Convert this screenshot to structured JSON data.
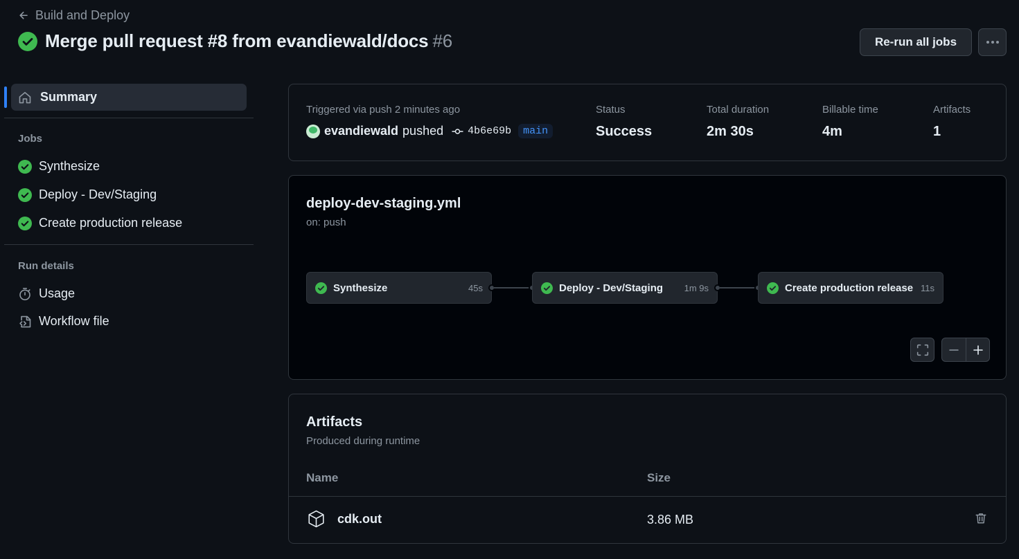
{
  "header": {
    "back_label": "Build and Deploy",
    "title": "Merge pull request #8 from evandiewald/docs",
    "run_number": "#6",
    "rerun_label": "Re-run all jobs",
    "more_icon": "kebab-horizontal-icon"
  },
  "sidebar": {
    "summary_label": "Summary",
    "jobs_heading": "Jobs",
    "jobs": [
      {
        "label": "Synthesize",
        "status": "success"
      },
      {
        "label": "Deploy - Dev/Staging",
        "status": "success"
      },
      {
        "label": "Create production release",
        "status": "success"
      }
    ],
    "run_details_heading": "Run details",
    "run_details": [
      {
        "label": "Usage",
        "icon": "stopwatch-icon"
      },
      {
        "label": "Workflow file",
        "icon": "file-code-icon"
      }
    ]
  },
  "summary": {
    "triggered_text": "Triggered via push 2 minutes ago",
    "actor": "evandiewald",
    "action": "pushed",
    "commit": "4b6e69b",
    "branch": "main",
    "status_label": "Status",
    "status_value": "Success",
    "duration_label": "Total duration",
    "duration_value": "2m 30s",
    "billable_label": "Billable time",
    "billable_value": "4m",
    "artifacts_label": "Artifacts",
    "artifacts_value": "1"
  },
  "workflow": {
    "file_name": "deploy-dev-staging.yml",
    "trigger": "on: push",
    "jobs": [
      {
        "name": "Synthesize",
        "duration": "45s"
      },
      {
        "name": "Deploy - Dev/Staging",
        "duration": "1m 9s"
      },
      {
        "name": "Create production release",
        "duration": "11s"
      }
    ]
  },
  "artifacts": {
    "title": "Artifacts",
    "subtitle": "Produced during runtime",
    "col_name": "Name",
    "col_size": "Size",
    "items": [
      {
        "name": "cdk.out",
        "size": "3.86 MB"
      }
    ]
  },
  "colors": {
    "background": "#0d1117",
    "success": "#3fb950",
    "accent": "#2f81f7",
    "branch": "#4493f8"
  }
}
